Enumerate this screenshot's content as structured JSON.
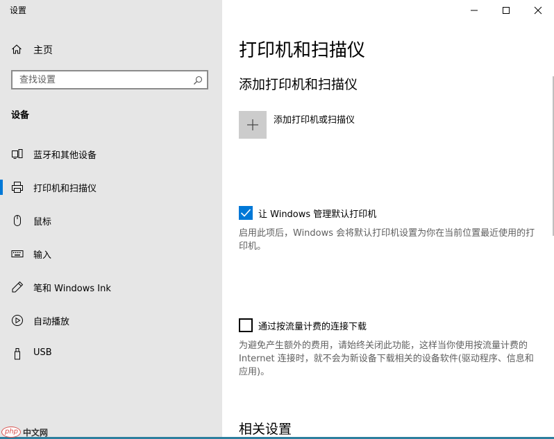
{
  "window": {
    "title": "设置",
    "controls": {
      "minimize": "minimize-icon",
      "maximize": "maximize-icon",
      "close": "close-icon"
    }
  },
  "sidebar": {
    "home": {
      "label": "主页",
      "icon": "home-icon"
    },
    "search": {
      "placeholder": "查找设置",
      "value": "",
      "icon": "search-icon"
    },
    "section_heading": "设备",
    "items": [
      {
        "label": "蓝牙和其他设备",
        "icon": "bluetooth-devices-icon",
        "selected": false
      },
      {
        "label": "打印机和扫描仪",
        "icon": "printer-icon",
        "selected": true
      },
      {
        "label": "鼠标",
        "icon": "mouse-icon",
        "selected": false
      },
      {
        "label": "输入",
        "icon": "keyboard-icon",
        "selected": false
      },
      {
        "label": "笔和 Windows Ink",
        "icon": "pen-icon",
        "selected": false
      },
      {
        "label": "自动播放",
        "icon": "autoplay-icon",
        "selected": false
      },
      {
        "label": "USB",
        "icon": "usb-icon",
        "selected": false
      }
    ]
  },
  "main": {
    "title": "打印机和扫描仪",
    "add_section": {
      "heading": "添加打印机和扫描仪",
      "button_label": "添加打印机或扫描仪",
      "icon": "plus-icon"
    },
    "default_printer": {
      "checked": true,
      "label": "让 Windows 管理默认打印机",
      "description": "启用此项后，Windows 会将默认打印机设置为你在当前位置最近使用的打印机。"
    },
    "metered_download": {
      "checked": false,
      "label": "通过按流量计费的连接下载",
      "description": "为避免产生额外的费用，请始终关闭此功能，这样当你使用按流量计费的 Internet 连接时，就不会为新设备下载相关的设备软件(驱动程序、信息和应用)。"
    },
    "related_heading": "相关设置"
  },
  "watermark": {
    "badge": "php",
    "text": "中文网"
  },
  "colors": {
    "accent": "#0078d7",
    "sidebar_bg": "#e6e6e6",
    "tile_bg": "#cccccc",
    "desc_text": "#5f5f5f"
  }
}
